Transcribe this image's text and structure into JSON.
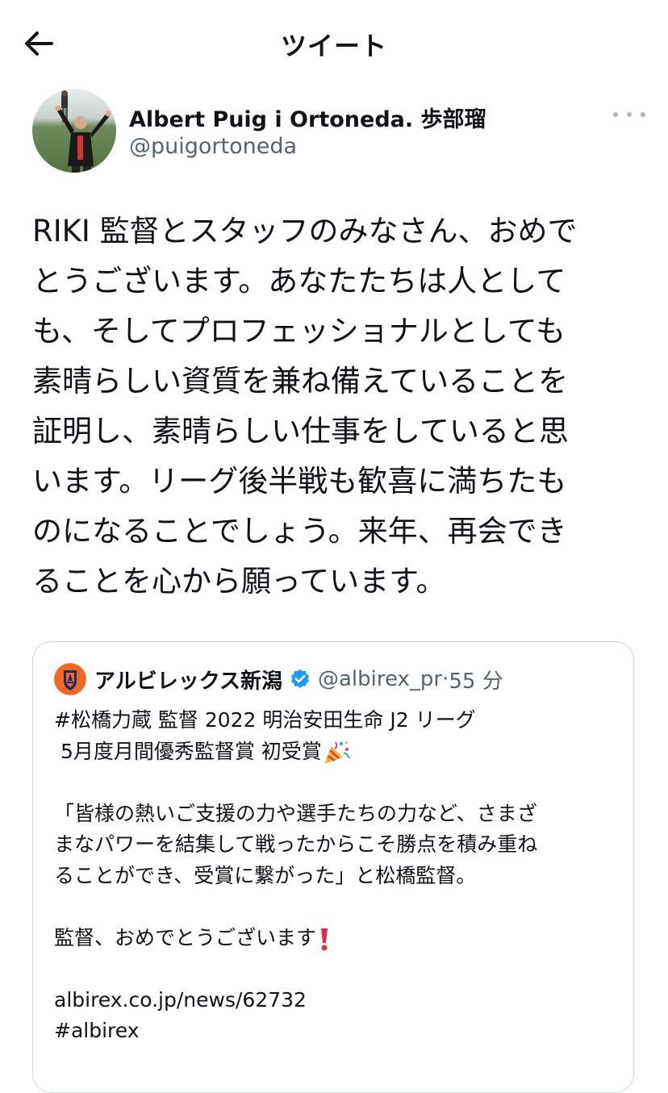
{
  "header": {
    "title": "ツイート"
  },
  "author": {
    "name": "Albert Puig i Ortoneda. 歩部瑠",
    "handle": "@puigortoneda"
  },
  "tweet": {
    "text": "RIKI 監督とスタッフのみなさん、おめで\nとうございます。あなたたちは人として\nも、そしてプロフェッショナルとしても\n素晴らしい資質を兼ね備えていることを\n証明し、素晴らしい仕事をしていると思\nいます。リーグ後半戦も歓喜に満ちたも\nのになることでしょう。来年、再会でき\nることを心から願っています。"
  },
  "quote": {
    "name": "アルビレックス新潟",
    "handle": "@albirex_pr",
    "separator": "·",
    "time": "55 分",
    "line1": "#松橋力蔵 監督 2022 明治安田生命 J2 リーグ",
    "line2": " 5月度月間優秀監督賞 初受賞",
    "para2": "「皆様の熱いご支援の力や選手たちの力など、さまざ\nまなパワーを結集して戦ったからこそ勝点を積み重ね\nることができ、受賞に繋がった」と松橋監督。",
    "para3": "監督、おめでとうございます",
    "link": "albirex.co.jp/news/62732",
    "hashtag": "#albirex"
  },
  "colors": {
    "text": "#0f1419",
    "secondary": "#536471",
    "border": "#cfd9de",
    "verified": "#1d9bf0",
    "albirex_orange": "#f26722",
    "albirex_navy": "#1b2a6b"
  },
  "icons": {
    "back": "arrow-left-icon",
    "more": "more-horizontal-icon",
    "verified": "verified-badge-icon",
    "party": "party-popper-emoji",
    "exclamation": "red-exclamation-emoji"
  }
}
